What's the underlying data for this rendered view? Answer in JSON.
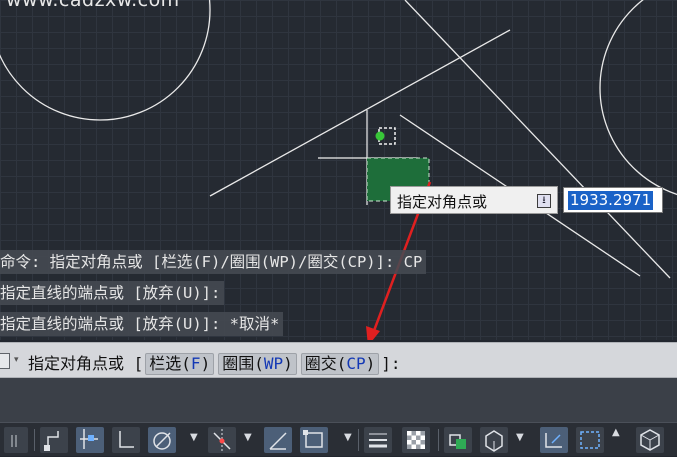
{
  "watermark": "www.cadzxw.com",
  "dynamic_input": {
    "prompt_label": "指定对角点或",
    "options_icon": "down-arrow-icon",
    "value": "1933.2971"
  },
  "command_history": [
    "命令: 指定对角点或 [栏选(F)/圈围(WP)/圈交(CP)]: CP",
    "指定直线的端点或 [放弃(U)]:",
    "指定直线的端点或 [放弃(U)]: *取消*"
  ],
  "command_line": {
    "prompt": "指定对角点或 [",
    "options": [
      {
        "label": "栏选(",
        "key": "F",
        "close": ")"
      },
      {
        "label": "圈围(",
        "key": "WP",
        "close": ")"
      },
      {
        "label": "圈交(",
        "key": "CP",
        "close": ")"
      }
    ],
    "suffix": "]:"
  },
  "status_bar": {
    "buttons": [
      "grid-icon",
      "snap-icon",
      "ortho-icon",
      "polar-icon",
      "osnap-track-icon",
      "isodraft-icon",
      "osnap-icon",
      "lineweight-icon",
      "transparency-icon",
      "selection-cycling-icon",
      "3d-osnap-icon",
      "dynamic-ucs-icon",
      "selection-filter-icon",
      "gizmo-icon"
    ]
  },
  "colors": {
    "canvas": "#252a32",
    "selection_fill": "#1e6e3a",
    "selection_highlight": "#1a62c7",
    "annotation_arrow": "#e02020"
  }
}
